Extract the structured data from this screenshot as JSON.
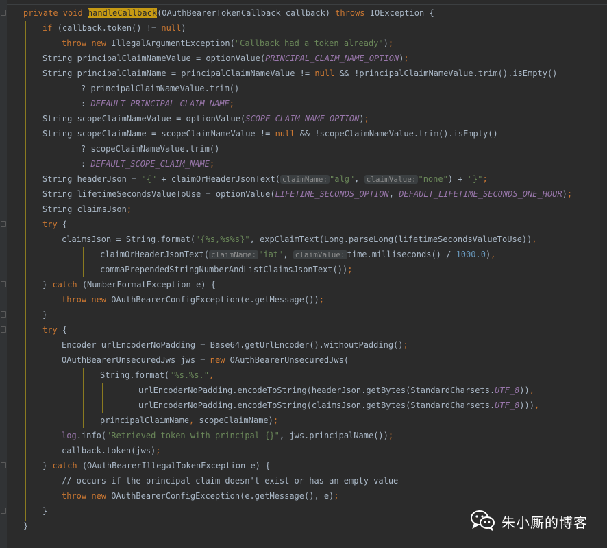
{
  "editor": {
    "lines": [
      "private void handleCallback(OAuthBearerTokenCallback callback) throws IOException {",
      "if (callback.token() != null)",
      "throw new IllegalArgumentException(\"Callback had a token already\");",
      "String principalClaimNameValue = optionValue(PRINCIPAL_CLAIM_NAME_OPTION);",
      "String principalClaimName = principalClaimNameValue != null && !principalClaimNameValue.trim().isEmpty()",
      "? principalClaimNameValue.trim()",
      ": DEFAULT_PRINCIPAL_CLAIM_NAME;",
      "String scopeClaimNameValue = optionValue(SCOPE_CLAIM_NAME_OPTION);",
      "String scopeClaimName = scopeClaimNameValue != null && !scopeClaimNameValue.trim().isEmpty()",
      "? scopeClaimNameValue.trim()",
      ": DEFAULT_SCOPE_CLAIM_NAME;",
      "String headerJson = \"{\" + claimOrHeaderJsonText(claimName: \"alg\", claimValue: \"none\") + \"}\";",
      "String lifetimeSecondsValueToUse = optionValue(LIFETIME_SECONDS_OPTION, DEFAULT_LIFETIME_SECONDS_ONE_HOUR);",
      "String claimsJson;",
      "try {",
      "claimsJson = String.format(\"{%s,%s%s}\", expClaimText(Long.parseLong(lifetimeSecondsValueToUse)),",
      "claimOrHeaderJsonText(claimName: \"iat\", claimValue: time.milliseconds() / 1000.0),",
      "commaPrependedStringNumberAndListClaimsJsonText());",
      "} catch (NumberFormatException e) {",
      "throw new OAuthBearerConfigException(e.getMessage());",
      "}",
      "try {",
      "Encoder urlEncoderNoPadding = Base64.getUrlEncoder().withoutPadding();",
      "OAuthBearerUnsecuredJws jws = new OAuthBearerUnsecuredJws(",
      "String.format(\"%s.%s.\",",
      "urlEncoderNoPadding.encodeToString(headerJson.getBytes(StandardCharsets.UTF_8)),",
      "urlEncoderNoPadding.encodeToString(claimsJson.getBytes(StandardCharsets.UTF_8))),",
      "principalClaimName, scopeClaimName);",
      "log.info(\"Retrieved token with principal {}\", jws.principalName());",
      "callback.token(jws);",
      "} catch (OAuthBearerIllegalTokenException e) {",
      "// occurs if the principal claim doesn't exist or has an empty value",
      "throw new OAuthBearerConfigException(e.getMessage(), e);",
      "}",
      "}"
    ]
  },
  "watermark": {
    "icon": "wechat-icon",
    "text": "朱小厮的博客"
  },
  "colors": {
    "background": "#2b2b2b",
    "keyword": "#cc7832",
    "string": "#6a8759",
    "constant": "#9876aa",
    "method": "#ffc66d",
    "number": "#6897bb",
    "text": "#a9b7c6"
  }
}
